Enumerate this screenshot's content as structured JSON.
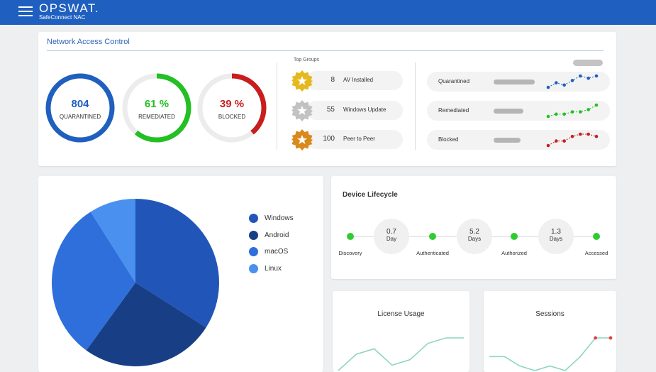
{
  "header": {
    "brand": "OPSWAT.",
    "subtitle": "SafeConnect NAC",
    "accent": "#1f5fbf"
  },
  "nac": {
    "title": "Network Access Control",
    "rings": [
      {
        "value": "804",
        "label": "QUARANTINED",
        "color": "#1f5fbf",
        "fraction": 1.0
      },
      {
        "value": "61 %",
        "label": "REMEDIATED",
        "color": "#22c022",
        "fraction": 0.61
      },
      {
        "value": "39 %",
        "label": "BLOCKED",
        "color": "#c81e1e",
        "fraction": 0.39
      }
    ],
    "top_groups_title": "Top Groups",
    "top_groups": [
      {
        "count": "8",
        "name": "AV Installed",
        "badge": "gold-badge-icon",
        "color": "#e6b820"
      },
      {
        "count": "55",
        "name": "Windows Update",
        "badge": "silver-badge-icon",
        "color": "#c2c2c2"
      },
      {
        "count": "100",
        "name": "Peer to Peer",
        "badge": "bronze-badge-icon",
        "color": "#d98a1c"
      }
    ],
    "stats": [
      {
        "label": "Quarantined",
        "color": "#1f5fbf",
        "trend": [
          3,
          5,
          4,
          6,
          8,
          7,
          8
        ]
      },
      {
        "label": "Remediated",
        "color": "#22c022",
        "trend": [
          2,
          3,
          3,
          4,
          4,
          5,
          7
        ]
      },
      {
        "label": "Blocked",
        "color": "#c81e1e",
        "trend": [
          2,
          4,
          4,
          6,
          7,
          7,
          6
        ]
      }
    ]
  },
  "os_chart": {
    "chart_data": {
      "type": "pie",
      "title": "",
      "slices": [
        {
          "name": "Windows",
          "value": 34,
          "color": "#2255b8"
        },
        {
          "name": "Android",
          "value": 26,
          "color": "#183f86"
        },
        {
          "name": "macOS",
          "value": 31,
          "color": "#2f6fdc"
        },
        {
          "name": "Linux",
          "value": 9,
          "color": "#4a90ee"
        }
      ]
    }
  },
  "lifecycle": {
    "title": "Device Lifecycle",
    "stages": [
      "Discovery",
      "Authenticated",
      "Authorized",
      "Accessed"
    ],
    "durations": [
      {
        "value": "0.7",
        "unit": "Day"
      },
      {
        "value": "5.2",
        "unit": "Days"
      },
      {
        "value": "1.3",
        "unit": "Days"
      }
    ]
  },
  "license_usage": {
    "title": "License Usage",
    "line_color": "#8ed5c2",
    "trend": [
      2,
      5,
      6,
      3,
      4,
      7,
      8,
      8
    ]
  },
  "sessions": {
    "title": "Sessions",
    "line_color": "#8ed5c2",
    "point_color": "#e04040",
    "trend": [
      4,
      4,
      2,
      1,
      2,
      1,
      4,
      8,
      8
    ]
  }
}
